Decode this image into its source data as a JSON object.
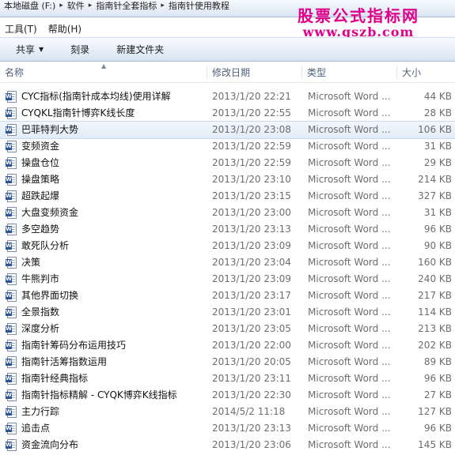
{
  "address": {
    "crumbs": [
      "本地磁盘 (F:)",
      "软件",
      "指南针全套指标",
      "指南针使用教程"
    ]
  },
  "watermark": {
    "line1": "股票公式指标网",
    "line2": "www.gszb.com"
  },
  "menu": {
    "items": [
      "工具(T)",
      "帮助(H)"
    ]
  },
  "toolbar": {
    "share": "共享",
    "burn": "刻录",
    "new_folder": "新建文件夹"
  },
  "columns": {
    "name": "名称",
    "date": "修改日期",
    "type": "类型",
    "size": "大小"
  },
  "files": [
    {
      "name": "CYC指标(指南针成本均线)使用详解",
      "date": "2013/1/20 22:21",
      "type": "Microsoft Word ...",
      "size": "44 KB"
    },
    {
      "name": "CYQKL指南针博弈K线长度",
      "date": "2013/1/20 22:55",
      "type": "Microsoft Word ...",
      "size": "28 KB"
    },
    {
      "name": "巴菲特判大势",
      "date": "2013/1/20 23:08",
      "type": "Microsoft Word ...",
      "size": "106 KB"
    },
    {
      "name": "变频资金",
      "date": "2013/1/20 22:59",
      "type": "Microsoft Word ...",
      "size": "31 KB"
    },
    {
      "name": "操盘仓位",
      "date": "2013/1/20 22:59",
      "type": "Microsoft Word ...",
      "size": "29 KB"
    },
    {
      "name": "操盘策略",
      "date": "2013/1/20 23:10",
      "type": "Microsoft Word ...",
      "size": "214 KB"
    },
    {
      "name": "超跌起爆",
      "date": "2013/1/20 23:15",
      "type": "Microsoft Word ...",
      "size": "327 KB"
    },
    {
      "name": "大盘变频资金",
      "date": "2013/1/20 23:00",
      "type": "Microsoft Word ...",
      "size": "31 KB"
    },
    {
      "name": "多空趋势",
      "date": "2013/1/20 23:13",
      "type": "Microsoft Word ...",
      "size": "96 KB"
    },
    {
      "name": "敢死队分析",
      "date": "2013/1/20 23:09",
      "type": "Microsoft Word ...",
      "size": "90 KB"
    },
    {
      "name": "决策",
      "date": "2013/1/20 23:04",
      "type": "Microsoft Word ...",
      "size": "160 KB"
    },
    {
      "name": "牛熊判市",
      "date": "2013/1/20 23:09",
      "type": "Microsoft Word ...",
      "size": "240 KB"
    },
    {
      "name": "其他界面切换",
      "date": "2013/1/20 23:17",
      "type": "Microsoft Word ...",
      "size": "217 KB"
    },
    {
      "name": "全景指数",
      "date": "2013/1/20 23:01",
      "type": "Microsoft Word ...",
      "size": "114 KB"
    },
    {
      "name": "深度分析",
      "date": "2013/1/20 23:05",
      "type": "Microsoft Word ...",
      "size": "213 KB"
    },
    {
      "name": "指南针筹码分布运用技巧",
      "date": "2013/1/20 22:00",
      "type": "Microsoft Word ...",
      "size": "202 KB"
    },
    {
      "name": "指南针活筹指数运用",
      "date": "2013/1/20 20:05",
      "type": "Microsoft Word ...",
      "size": "89 KB"
    },
    {
      "name": "指南针经典指标",
      "date": "2013/1/20 23:11",
      "type": "Microsoft Word ...",
      "size": "96 KB"
    },
    {
      "name": "指南针指标精解 - CYQK博弈K线指标",
      "date": "2013/1/20 22:30",
      "type": "Microsoft Word ...",
      "size": "27 KB"
    },
    {
      "name": "主力行踪",
      "date": "2014/5/2 11:18",
      "type": "Microsoft Word ...",
      "size": "127 KB"
    },
    {
      "name": "追击点",
      "date": "2013/1/20 23:13",
      "type": "Microsoft Word ...",
      "size": "96 KB"
    },
    {
      "name": "资金流向分布",
      "date": "2013/1/20 23:06",
      "type": "Microsoft Word ...",
      "size": "145 KB"
    }
  ],
  "icons": {
    "file": "word-document-icon"
  }
}
